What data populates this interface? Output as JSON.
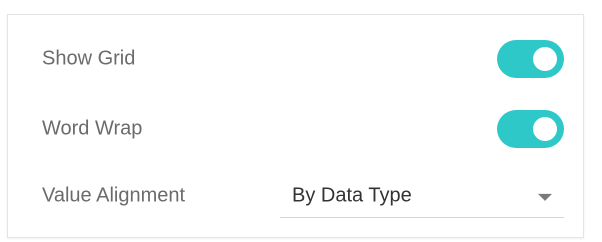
{
  "settings": {
    "show_grid": {
      "label": "Show Grid",
      "enabled": true
    },
    "word_wrap": {
      "label": "Word Wrap",
      "enabled": true
    },
    "value_alignment": {
      "label": "Value Alignment",
      "selected": "By Data Type",
      "icon": "chevron-down-icon"
    }
  },
  "colors": {
    "toggle_on": "#2ec8c8",
    "label_text": "#6b6b6b",
    "value_text": "#333333"
  }
}
